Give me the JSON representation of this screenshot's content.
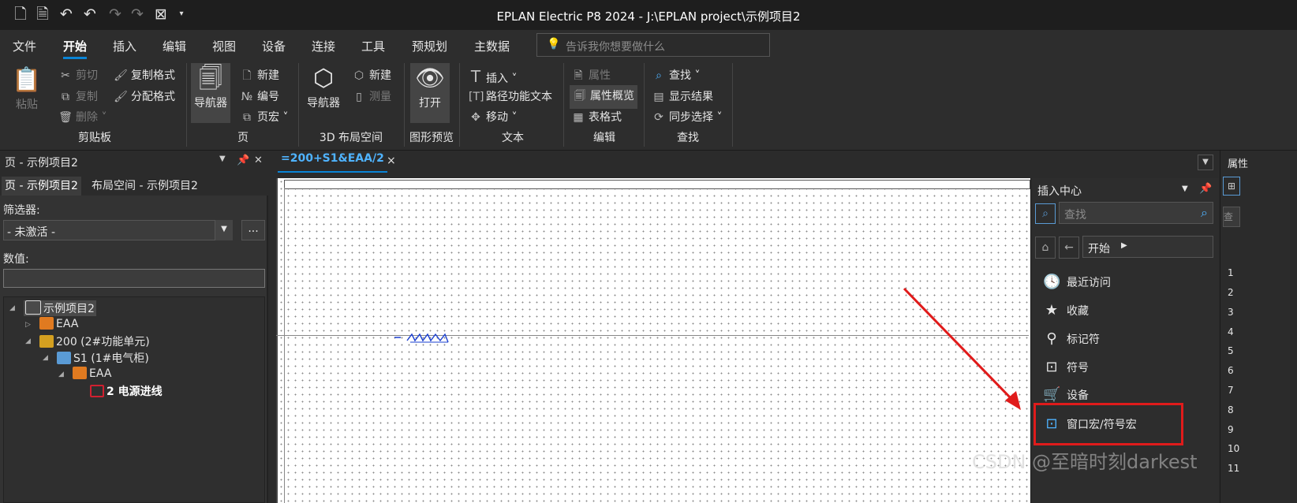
{
  "window": {
    "title": "EPLAN Electric P8 2024 - J:\\EPLAN project\\示例项目2"
  },
  "quick_access": [
    "new-page-icon",
    "new-doc-icon",
    "undo-icon",
    "undo-step-icon",
    "redo-icon",
    "redo-step-icon",
    "filter-icon",
    "dropdown-icon"
  ],
  "tabs": [
    "文件",
    "开始",
    "插入",
    "编辑",
    "视图",
    "设备",
    "连接",
    "工具",
    "预规划",
    "主数据"
  ],
  "active_tab": "开始",
  "search": {
    "placeholder": "告诉我你想要做什么"
  },
  "ribbon": {
    "clipboard": {
      "paste": "粘贴",
      "cut": "剪切",
      "copy": "复制",
      "delete": "删除",
      "copy_format": "复制格式",
      "assign_format": "分配格式",
      "group": "剪贴板"
    },
    "page": {
      "navigator": "导航器",
      "new": "新建",
      "number": "编号",
      "page_macro": "页宏",
      "group": "页"
    },
    "layout3d": {
      "navigator": "导航器",
      "new": "新建",
      "measure": "测量",
      "group": "3D 布局空间"
    },
    "preview": {
      "open": "打开",
      "group": "图形预览"
    },
    "text": {
      "insert": "插入",
      "path_text": "路径功能文本",
      "move": "移动",
      "group": "文本"
    },
    "edit": {
      "properties": "属性",
      "prop_overview": "属性概览",
      "table_format": "表格式",
      "group": "编辑"
    },
    "find": {
      "find": "查找",
      "show_results": "显示结果",
      "sync_select": "同步选择",
      "group": "查找"
    }
  },
  "left_panel": {
    "title": "页 - 示例项目2",
    "tabs": [
      "页 - 示例项目2",
      "布局空间 - 示例项目2"
    ],
    "filter_label": "筛选器:",
    "filter_value": "- 未激活 -",
    "more_button": "...",
    "value_label": "数值:",
    "value": "",
    "tree": [
      "示例项目2",
      "EAA",
      "200 (2#功能单元)",
      "S1 (1#电气柜)",
      "EAA",
      "2 电源进线"
    ]
  },
  "document_tab": {
    "label": "=200+S1&EAA/2",
    "close": "×"
  },
  "insert_center": {
    "title": "插入中心",
    "search_placeholder": "查找",
    "nav_label": "开始",
    "items": [
      "最近访问",
      "收藏",
      "标记符",
      "符号",
      "设备",
      "窗口宏/符号宏"
    ]
  },
  "right_panel": {
    "title": "属性",
    "search": "查",
    "rows": [
      "1",
      "2",
      "3",
      "4",
      "5",
      "6",
      "7",
      "8",
      "9",
      "10",
      "11"
    ]
  },
  "watermark": "CSDN @至暗时刻darkest"
}
